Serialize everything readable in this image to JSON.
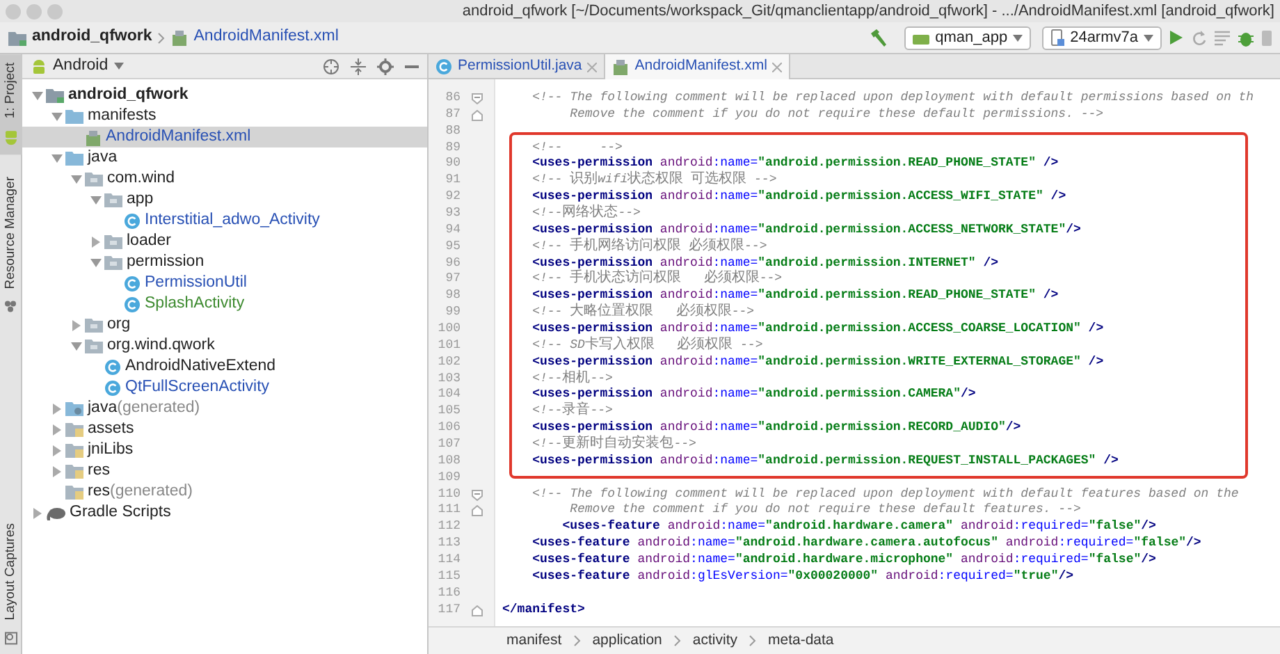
{
  "window": {
    "title": "android_qfwork [~/Documents/workspack_Git/qmanclientapp/android_qfwork] - .../AndroidManifest.xml [android_qfwork]"
  },
  "navigation": {
    "crumbs": [
      {
        "label": "android_qfwork",
        "kind": "module"
      },
      {
        "label": "AndroidManifest.xml",
        "kind": "manifest"
      }
    ],
    "run_config": "qman_app",
    "device": "24armv7a"
  },
  "tool_windows": [
    {
      "label": "1: Project",
      "selected": true
    },
    {
      "label": "Resource Manager",
      "selected": false
    },
    {
      "label": "Layout Captures",
      "selected": false
    }
  ],
  "project": {
    "view": "Android",
    "tree": [
      {
        "label": "android_qfwork",
        "kind": "module",
        "color": "#222222",
        "selected": false,
        "expanded": true,
        "children": [
          {
            "label": "manifests",
            "kind": "folder",
            "color": "#222222",
            "selected": false,
            "expanded": true,
            "children": [
              {
                "label": "AndroidManifest.xml",
                "kind": "manifest",
                "color": "#2850b4",
                "selected": true
              }
            ]
          },
          {
            "label": "java",
            "kind": "folder",
            "color": "#222222",
            "selected": false,
            "expanded": true,
            "children": [
              {
                "label": "com.wind",
                "kind": "package",
                "color": "#222222",
                "selected": false,
                "expanded": true,
                "children": [
                  {
                    "label": "app",
                    "kind": "package",
                    "color": "#222222",
                    "selected": false,
                    "expanded": true,
                    "children": [
                      {
                        "label": "Interstitial_adwo_Activity",
                        "kind": "class",
                        "color": "#2850b4",
                        "selected": false
                      }
                    ]
                  },
                  {
                    "label": "loader",
                    "kind": "package",
                    "color": "#222222",
                    "selected": false,
                    "expanded": false
                  },
                  {
                    "label": "permission",
                    "kind": "package",
                    "color": "#222222",
                    "selected": false,
                    "expanded": true,
                    "children": [
                      {
                        "label": "PermissionUtil",
                        "kind": "class",
                        "color": "#2850b4",
                        "selected": false
                      },
                      {
                        "label": "SplashActivity",
                        "kind": "class",
                        "color": "#3d8a2f",
                        "selected": false
                      }
                    ]
                  }
                ]
              },
              {
                "label": "org",
                "kind": "package",
                "color": "#222222",
                "selected": false,
                "expanded": false
              },
              {
                "label": "org.wind.qwork",
                "kind": "package",
                "color": "#222222",
                "selected": false,
                "expanded": true,
                "children": [
                  {
                    "label": "AndroidNativeExtend",
                    "kind": "class",
                    "color": "#222222",
                    "selected": false
                  },
                  {
                    "label": "QtFullScreenActivity",
                    "kind": "class",
                    "color": "#2850b4",
                    "selected": false
                  }
                ]
              }
            ]
          },
          {
            "label": "java",
            "note": "(generated)",
            "kind": "generated-folder",
            "color": "#222222",
            "selected": false,
            "expanded": false
          },
          {
            "label": "assets",
            "kind": "resource-folder",
            "color": "#222222",
            "selected": false,
            "expanded": false
          },
          {
            "label": "jniLibs",
            "kind": "resource-folder",
            "color": "#222222",
            "selected": false,
            "expanded": false
          },
          {
            "label": "res",
            "kind": "resource-folder",
            "color": "#222222",
            "selected": false,
            "expanded": false
          },
          {
            "label": "res",
            "note": "(generated)",
            "kind": "resource-folder",
            "color": "#222222",
            "selected": false
          }
        ]
      },
      {
        "label": "Gradle Scripts",
        "kind": "gradle",
        "color": "#222222",
        "selected": false,
        "expanded": false
      }
    ]
  },
  "editor": {
    "tabs": [
      {
        "label": "PermissionUtil.java",
        "kind": "class",
        "selected": false
      },
      {
        "label": "AndroidManifest.xml",
        "kind": "manifest",
        "selected": true
      }
    ],
    "blocks": [
      {
        "highlighted": false,
        "lines": [
          {
            "number": "86",
            "kind": "fold-start",
            "tokens": [
              {
                "kind": "comment",
                "text": "    <!-- The following comment will be replaced upon deployment with default permissions based on th"
              }
            ]
          },
          {
            "number": "87",
            "kind": "fold-end",
            "tokens": [
              {
                "kind": "comment",
                "text": "         Remove the comment if you do not require these default permissions. -->"
              }
            ]
          },
          {
            "number": "88",
            "kind": "code"
          }
        ]
      },
      {
        "highlighted": true,
        "lines": [
          {
            "number": "89",
            "kind": "code",
            "tokens": [
              {
                "kind": "comment",
                "text": "    <!--     -->"
              }
            ]
          },
          {
            "number": "90",
            "kind": "code",
            "tokens": [
              {
                "kind": "tag",
                "text": "    <uses-permission"
              },
              {
                "kind": "ns",
                "text": " android"
              },
              {
                "kind": "attr",
                "text": ":name="
              },
              {
                "kind": "value",
                "text": "\"android.permission.READ_PHONE_STATE\""
              },
              {
                "kind": "tag",
                "text": " />"
              }
            ]
          },
          {
            "number": "91",
            "kind": "code",
            "tokens": [
              {
                "kind": "comment",
                "text": "    <!-- 识别wifi状态权限 可选权限 -->"
              }
            ]
          },
          {
            "number": "92",
            "kind": "code",
            "tokens": [
              {
                "kind": "tag",
                "text": "    <uses-permission"
              },
              {
                "kind": "ns",
                "text": " android"
              },
              {
                "kind": "attr",
                "text": ":name="
              },
              {
                "kind": "value",
                "text": "\"android.permission.ACCESS_WIFI_STATE\""
              },
              {
                "kind": "tag",
                "text": " />"
              }
            ]
          },
          {
            "number": "93",
            "kind": "code",
            "tokens": [
              {
                "kind": "comment",
                "text": "    <!--网络状态-->"
              }
            ]
          },
          {
            "number": "94",
            "kind": "code",
            "tokens": [
              {
                "kind": "tag",
                "text": "    <uses-permission"
              },
              {
                "kind": "ns",
                "text": " android"
              },
              {
                "kind": "attr",
                "text": ":name="
              },
              {
                "kind": "value",
                "text": "\"android.permission.ACCESS_NETWORK_STATE\""
              },
              {
                "kind": "tag",
                "text": "/>"
              }
            ]
          },
          {
            "number": "95",
            "kind": "code",
            "tokens": [
              {
                "kind": "comment",
                "text": "    <!-- 手机网络访问权限 必须权限-->"
              }
            ]
          },
          {
            "number": "96",
            "kind": "code",
            "tokens": [
              {
                "kind": "tag",
                "text": "    <uses-permission"
              },
              {
                "kind": "ns",
                "text": " android"
              },
              {
                "kind": "attr",
                "text": ":name="
              },
              {
                "kind": "value",
                "text": "\"android.permission.INTERNET\""
              },
              {
                "kind": "tag",
                "text": " />"
              }
            ]
          },
          {
            "number": "97",
            "kind": "code",
            "tokens": [
              {
                "kind": "comment",
                "text": "    <!-- 手机状态访问权限   必须权限-->"
              }
            ]
          },
          {
            "number": "98",
            "kind": "code",
            "tokens": [
              {
                "kind": "tag",
                "text": "    <uses-permission"
              },
              {
                "kind": "ns",
                "text": " android"
              },
              {
                "kind": "attr",
                "text": ":name="
              },
              {
                "kind": "value",
                "text": "\"android.permission.READ_PHONE_STATE\""
              },
              {
                "kind": "tag",
                "text": " />"
              }
            ]
          },
          {
            "number": "99",
            "kind": "code",
            "tokens": [
              {
                "kind": "comment",
                "text": "    <!-- 大略位置权限   必须权限-->"
              }
            ]
          },
          {
            "number": "100",
            "kind": "code",
            "tokens": [
              {
                "kind": "tag",
                "text": "    <uses-permission"
              },
              {
                "kind": "ns",
                "text": " android"
              },
              {
                "kind": "attr",
                "text": ":name="
              },
              {
                "kind": "value",
                "text": "\"android.permission.ACCESS_COARSE_LOCATION\""
              },
              {
                "kind": "tag",
                "text": " />"
              }
            ]
          },
          {
            "number": "101",
            "kind": "code",
            "tokens": [
              {
                "kind": "comment",
                "text": "    <!-- SD卡写入权限   必须权限 -->"
              }
            ]
          },
          {
            "number": "102",
            "kind": "code",
            "tokens": [
              {
                "kind": "tag",
                "text": "    <uses-permission"
              },
              {
                "kind": "ns",
                "text": " android"
              },
              {
                "kind": "attr",
                "text": ":name="
              },
              {
                "kind": "value",
                "text": "\"android.permission.WRITE_EXTERNAL_STORAGE\""
              },
              {
                "kind": "tag",
                "text": " />"
              }
            ]
          },
          {
            "number": "103",
            "kind": "code",
            "tokens": [
              {
                "kind": "comment",
                "text": "    <!--相机-->"
              }
            ]
          },
          {
            "number": "104",
            "kind": "code",
            "tokens": [
              {
                "kind": "tag",
                "text": "    <uses-permission"
              },
              {
                "kind": "ns",
                "text": " android"
              },
              {
                "kind": "attr",
                "text": ":name="
              },
              {
                "kind": "value",
                "text": "\"android.permission.CAMERA\""
              },
              {
                "kind": "tag",
                "text": "/>"
              }
            ]
          },
          {
            "number": "105",
            "kind": "code",
            "tokens": [
              {
                "kind": "comment",
                "text": "    <!--录音-->"
              }
            ]
          },
          {
            "number": "106",
            "kind": "code",
            "tokens": [
              {
                "kind": "tag",
                "text": "    <uses-permission"
              },
              {
                "kind": "ns",
                "text": " android"
              },
              {
                "kind": "attr",
                "text": ":name="
              },
              {
                "kind": "value",
                "text": "\"android.permission.RECORD_AUDIO\""
              },
              {
                "kind": "tag",
                "text": "/>"
              }
            ]
          },
          {
            "number": "107",
            "kind": "code",
            "tokens": [
              {
                "kind": "comment",
                "text": "    <!--更新时自动安装包-->"
              }
            ]
          },
          {
            "number": "108",
            "kind": "code",
            "tokens": [
              {
                "kind": "tag",
                "text": "    <uses-permission"
              },
              {
                "kind": "ns",
                "text": " android"
              },
              {
                "kind": "attr",
                "text": ":name="
              },
              {
                "kind": "value",
                "text": "\"android.permission.REQUEST_INSTALL_PACKAGES\""
              },
              {
                "kind": "tag",
                "text": " />"
              }
            ]
          }
        ]
      },
      {
        "highlighted": false,
        "lines": [
          {
            "number": "109",
            "kind": "code"
          },
          {
            "number": "110",
            "kind": "fold-start",
            "tokens": [
              {
                "kind": "comment",
                "text": "    <!-- The following comment will be replaced upon deployment with default features based on the"
              }
            ]
          },
          {
            "number": "111",
            "kind": "fold-end",
            "tokens": [
              {
                "kind": "comment",
                "text": "         Remove the comment if you do not require these default features. -->"
              }
            ]
          },
          {
            "number": "112",
            "kind": "code",
            "tokens": [
              {
                "kind": "tag",
                "text": "        <uses-feature"
              },
              {
                "kind": "ns",
                "text": " android"
              },
              {
                "kind": "attr",
                "text": ":name="
              },
              {
                "kind": "value",
                "text": "\"android.hardware.camera\""
              },
              {
                "kind": "ns",
                "text": " android"
              },
              {
                "kind": "attr",
                "text": ":required="
              },
              {
                "kind": "value",
                "text": "\"false\""
              },
              {
                "kind": "tag",
                "text": "/>"
              }
            ]
          },
          {
            "number": "113",
            "kind": "code",
            "tokens": [
              {
                "kind": "tag",
                "text": "    <uses-feature"
              },
              {
                "kind": "ns",
                "text": " android"
              },
              {
                "kind": "attr",
                "text": ":name="
              },
              {
                "kind": "value",
                "text": "\"android.hardware.camera.autofocus\""
              },
              {
                "kind": "ns",
                "text": " android"
              },
              {
                "kind": "attr",
                "text": ":required="
              },
              {
                "kind": "value",
                "text": "\"false\""
              },
              {
                "kind": "tag",
                "text": "/>"
              }
            ]
          },
          {
            "number": "114",
            "kind": "code",
            "tokens": [
              {
                "kind": "tag",
                "text": "    <uses-feature"
              },
              {
                "kind": "ns",
                "text": " android"
              },
              {
                "kind": "attr",
                "text": ":name="
              },
              {
                "kind": "value",
                "text": "\"android.hardware.microphone\""
              },
              {
                "kind": "ns",
                "text": " android"
              },
              {
                "kind": "attr",
                "text": ":required="
              },
              {
                "kind": "value",
                "text": "\"false\""
              },
              {
                "kind": "tag",
                "text": "/>"
              }
            ]
          },
          {
            "number": "115",
            "kind": "code",
            "tokens": [
              {
                "kind": "tag",
                "text": "    <uses-feature"
              },
              {
                "kind": "ns",
                "text": " android"
              },
              {
                "kind": "attr",
                "text": ":glEsVersion="
              },
              {
                "kind": "value",
                "text": "\"0x00020000\""
              },
              {
                "kind": "ns",
                "text": " android"
              },
              {
                "kind": "attr",
                "text": ":required="
              },
              {
                "kind": "value",
                "text": "\"true\""
              },
              {
                "kind": "tag",
                "text": "/>"
              }
            ]
          },
          {
            "number": "116",
            "kind": "code"
          },
          {
            "number": "117",
            "kind": "fold-end",
            "tokens": [
              {
                "kind": "tag",
                "text": "</manifest>"
              }
            ]
          }
        ]
      }
    ],
    "breadcrumbs": [
      "manifest",
      "application",
      "activity",
      "meta-data"
    ]
  }
}
